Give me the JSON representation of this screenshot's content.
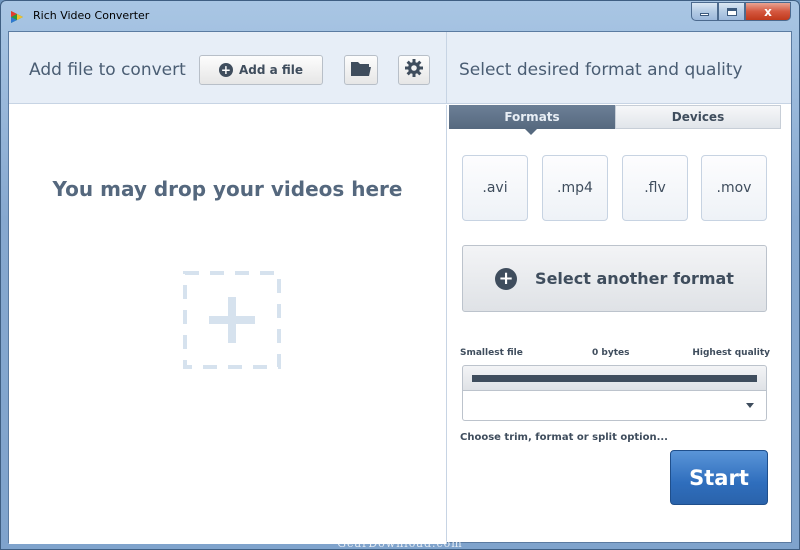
{
  "window": {
    "title": "Rich Video Converter",
    "app_icon": "rich-video-converter-logo-icon",
    "controls": {
      "minimize_icon": "minimize-icon",
      "maximize_icon": "maximize-icon",
      "close_label": "x"
    }
  },
  "toolbar": {
    "add_file_label": "Add file to convert",
    "add_file_button": "Add a file",
    "open_folder_icon": "folder-icon",
    "settings_icon": "gear-icon",
    "format_quality_label": "Select desired format and quality"
  },
  "drop_area": {
    "title": "You may drop your videos here",
    "drop_icon": "dashed-plus-icon"
  },
  "tabs": [
    {
      "label": "Formats",
      "active": true
    },
    {
      "label": "Devices",
      "active": false
    }
  ],
  "formats": [
    ".avi",
    ".mp4",
    ".flv",
    ".mov"
  ],
  "select_format_button": "Select another format",
  "quality": {
    "left_label": "Smallest file",
    "mid_label": "0 bytes",
    "right_label": "Highest quality",
    "level": 1.0
  },
  "dropdown": {
    "selected": ""
  },
  "trim_option": "Choose trim, format or split option...",
  "start_button": "Start",
  "watermark": "GearDownload.com",
  "colors": {
    "accent": "#2f6ebd",
    "text": "#3f4d5d",
    "toolbar_bg": "#e7eef7"
  }
}
